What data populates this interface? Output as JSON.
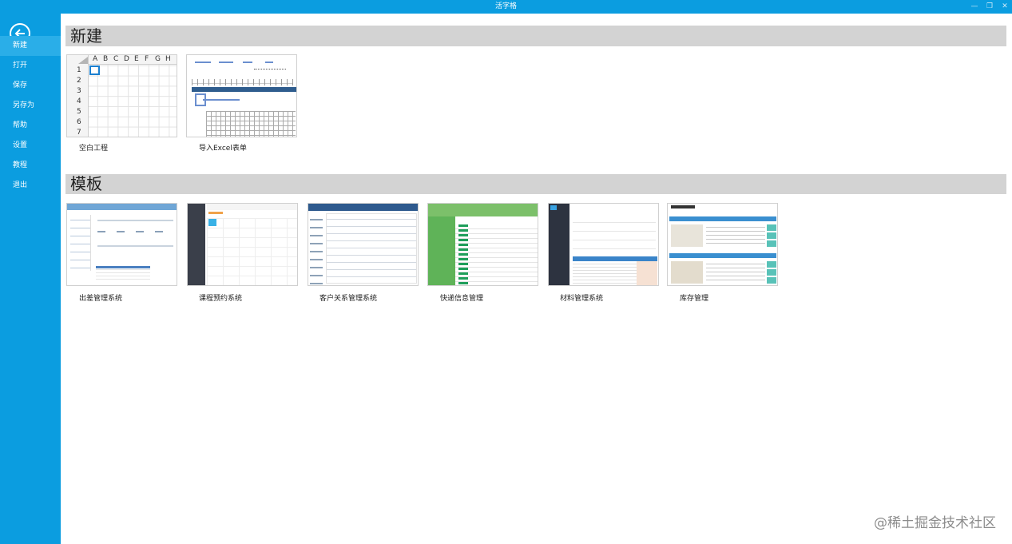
{
  "window": {
    "title": "活字格"
  },
  "sidebar": {
    "items": [
      {
        "label": "新建"
      },
      {
        "label": "打开"
      },
      {
        "label": "保存"
      },
      {
        "label": "另存为"
      },
      {
        "label": "帮助"
      },
      {
        "label": "设置"
      },
      {
        "label": "教程"
      },
      {
        "label": "退出"
      }
    ]
  },
  "new_section": {
    "heading": "新建",
    "items": [
      {
        "label": "空白工程",
        "columns": [
          "A",
          "B",
          "C",
          "D",
          "E",
          "F",
          "G",
          "H"
        ],
        "rows": [
          "1",
          "2",
          "3",
          "4",
          "5",
          "6",
          "7"
        ]
      },
      {
        "label": "导入Excel表单"
      }
    ]
  },
  "template_section": {
    "heading": "模板",
    "items": [
      {
        "label": "出差管理系统"
      },
      {
        "label": "课程预约系统"
      },
      {
        "label": "客户关系管理系统"
      },
      {
        "label": "快递信息管理"
      },
      {
        "label": "材料管理系统"
      },
      {
        "label": "库存管理"
      }
    ]
  },
  "watermark": "@稀土掘金技术社区"
}
